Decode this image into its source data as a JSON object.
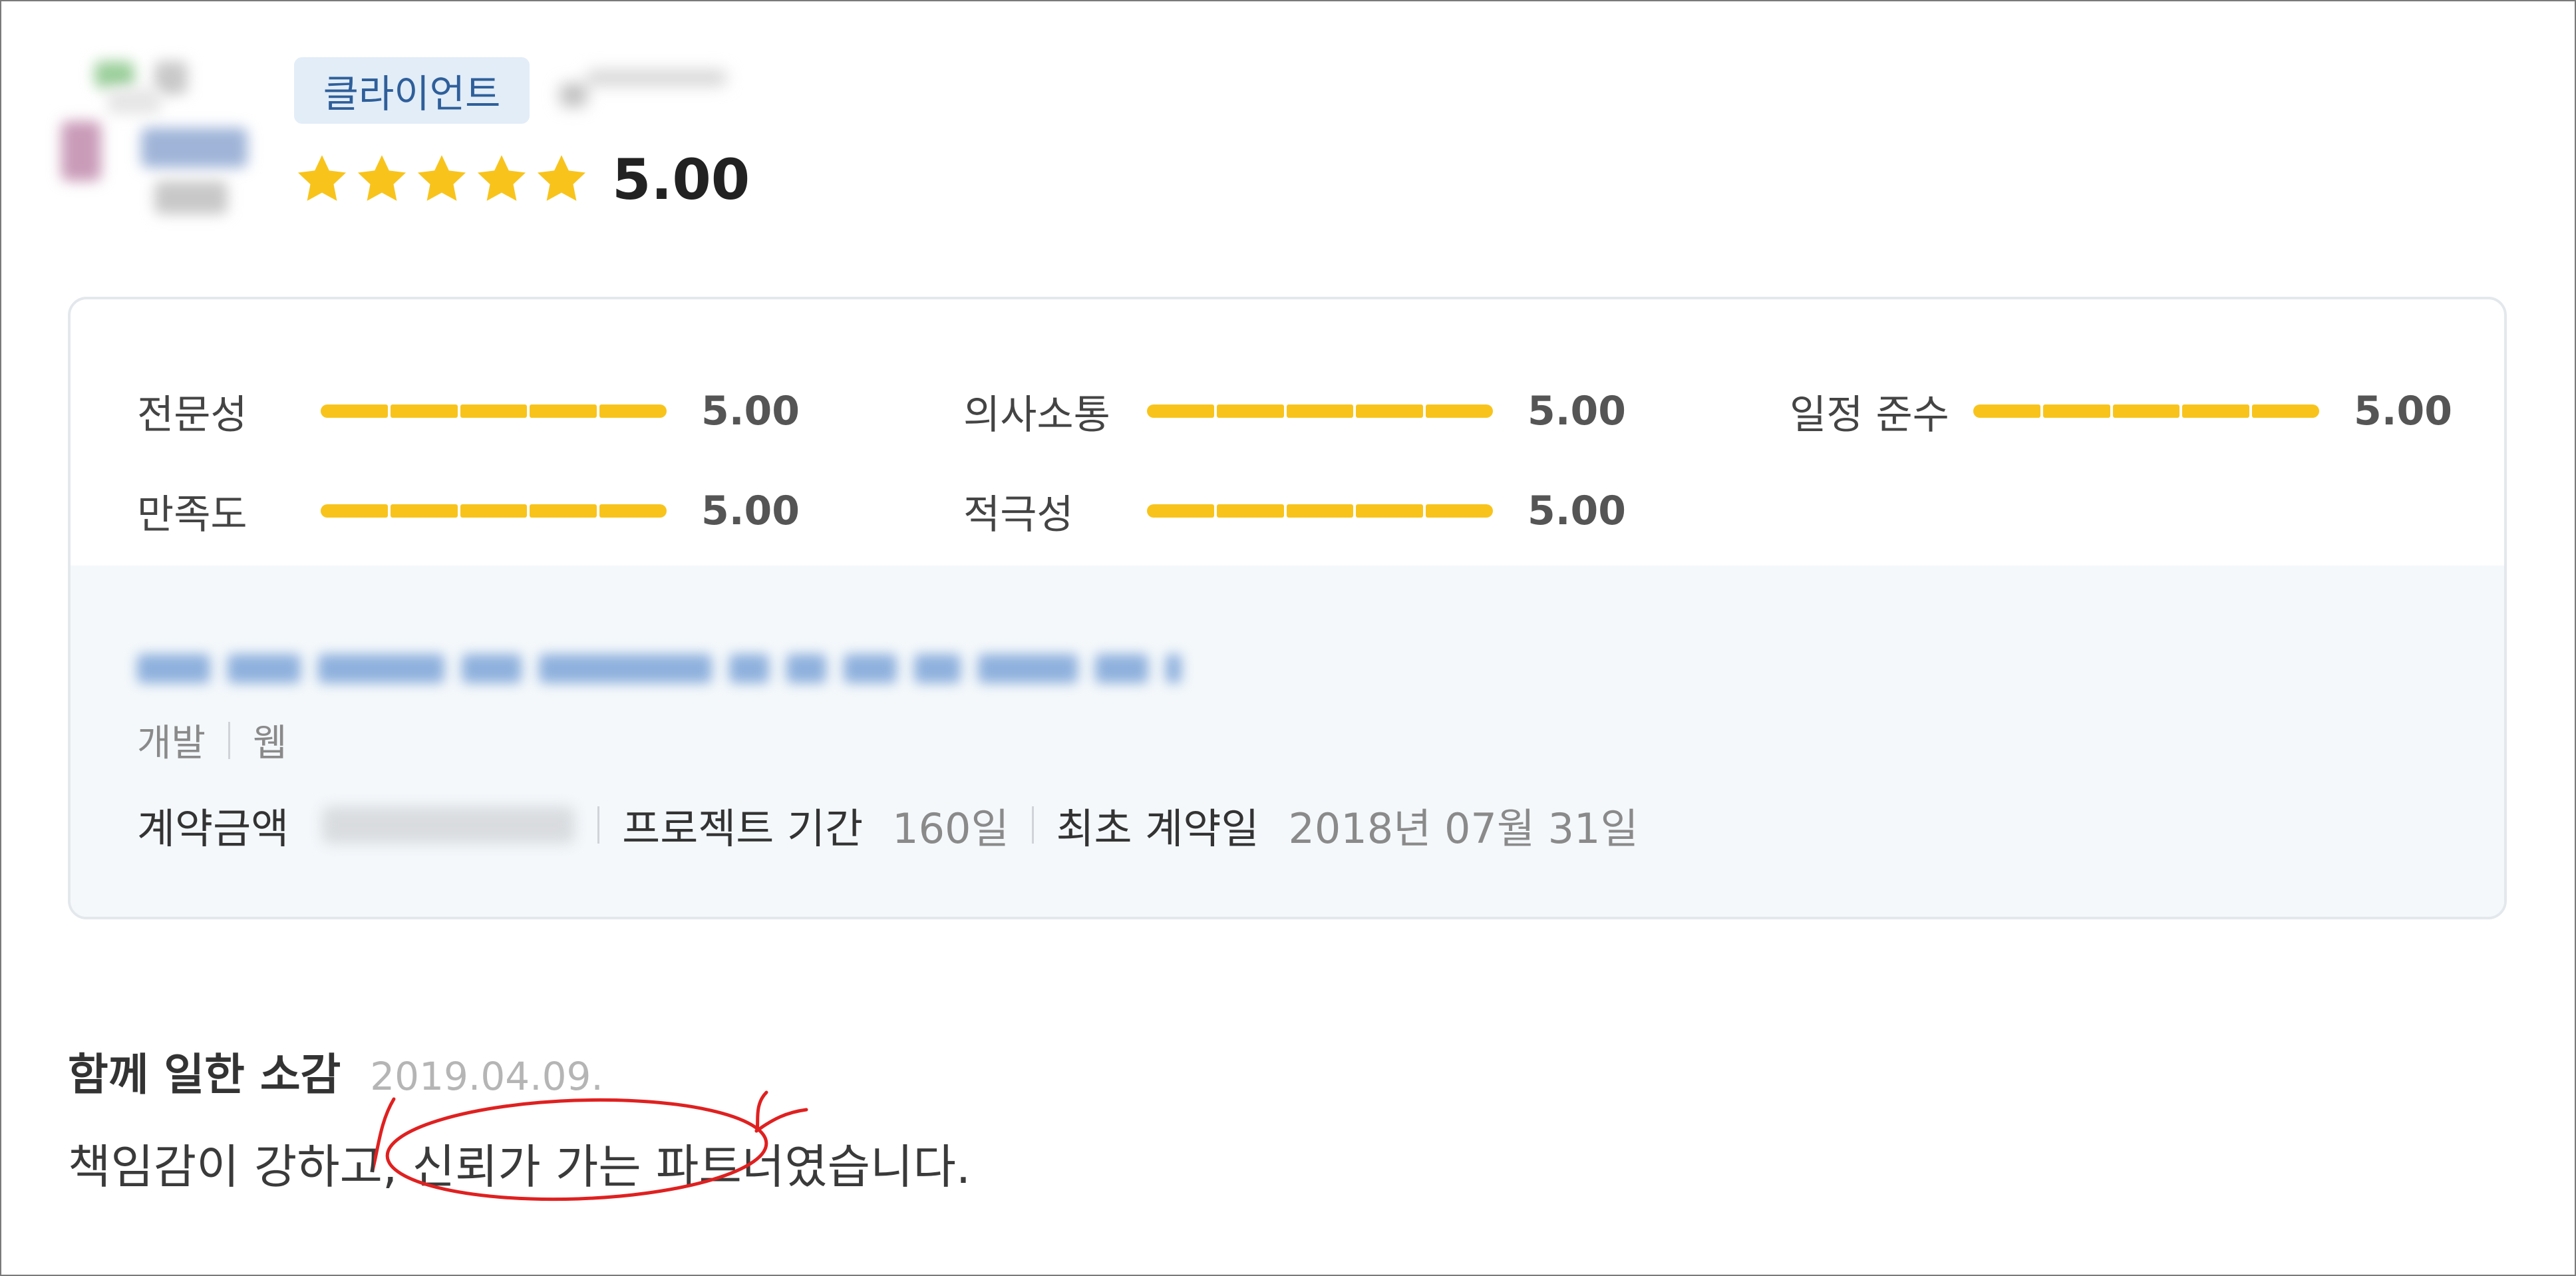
{
  "header": {
    "badge_label": "클라이언트",
    "rating": 5.0,
    "rating_text": "5.00",
    "star_count": 5
  },
  "scores": [
    {
      "label": "전문성",
      "value": 5.0,
      "value_text": "5.00"
    },
    {
      "label": "의사소통",
      "value": 5.0,
      "value_text": "5.00"
    },
    {
      "label": "일정 준수",
      "value": 5.0,
      "value_text": "5.00"
    },
    {
      "label": "만족도",
      "value": 5.0,
      "value_text": "5.00"
    },
    {
      "label": "적극성",
      "value": 5.0,
      "value_text": "5.00"
    }
  ],
  "project": {
    "category": "개발",
    "subcategory": "웹",
    "contract_amount_label": "계약금액",
    "duration_label": "프로젝트 기간",
    "duration_value": "160일",
    "first_contract_label": "최초 계약일",
    "first_contract_value": "2018년 07월 31일"
  },
  "review": {
    "title": "함께 일한 소감",
    "date": "2019.04.09.",
    "text": "책임감이 강하고, 신뢰가 가는 파트너였습니다."
  },
  "colors": {
    "star": "#f8c41c",
    "badge_bg": "#e2edf8",
    "badge_text": "#2f5f9a",
    "panel_bg": "#f4f8fb",
    "annotation": "#e02020"
  }
}
